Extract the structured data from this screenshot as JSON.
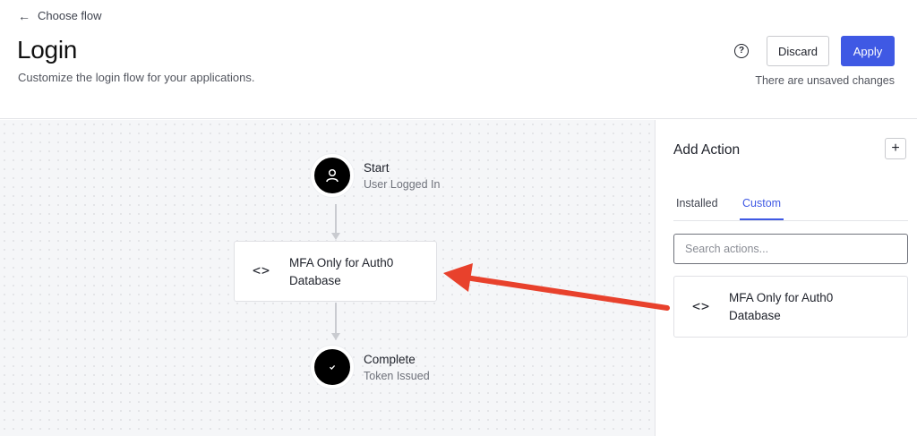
{
  "header": {
    "back_label": "Choose flow",
    "title": "Login",
    "subtitle": "Customize the login flow for your applications.",
    "help_icon": "?",
    "discard_label": "Discard",
    "apply_label": "Apply",
    "status": "There are unsaved changes"
  },
  "flow": {
    "start": {
      "title": "Start",
      "subtitle": "User Logged In",
      "icon": "user-icon"
    },
    "action": {
      "line1": "MFA Only for Auth0",
      "line2": "Database",
      "icon": "code-brackets-icon",
      "glyph": "<>"
    },
    "complete": {
      "title": "Complete",
      "subtitle": "Token Issued",
      "icon": "check-icon"
    }
  },
  "panel": {
    "title": "Add Action",
    "add_symbol": "+",
    "tabs": [
      {
        "label": "Installed",
        "active": false
      },
      {
        "label": "Custom",
        "active": true
      }
    ],
    "search_placeholder": "Search actions...",
    "actions": [
      {
        "line1": "MFA Only for Auth0",
        "line2": "Database",
        "icon": "code-brackets-icon",
        "glyph": "<>"
      }
    ]
  },
  "colors": {
    "accent": "#3f59e4",
    "annotation_arrow": "#e8412c",
    "node_fill": "#000000"
  }
}
